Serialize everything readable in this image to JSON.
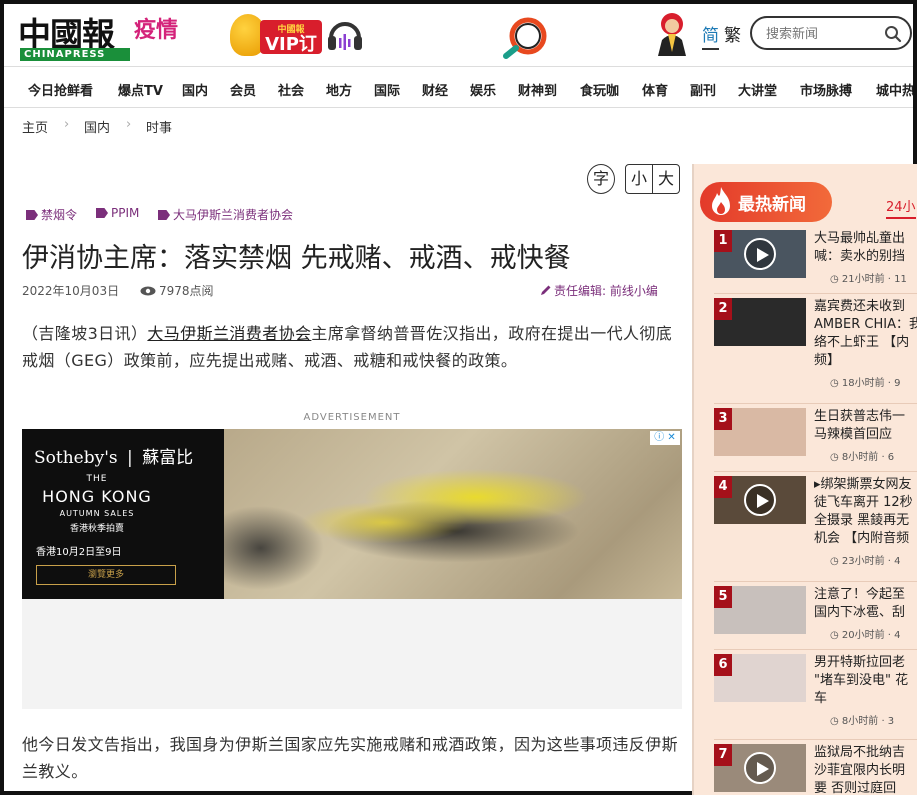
{
  "header": {
    "logo_cn": "中國報",
    "logo_epidemic": "疫情",
    "logo_en": "CHINAPRESS",
    "vip_small": "中國報",
    "vip_main": "VIP订阅",
    "lang_simplified": "简",
    "lang_traditional": "繁",
    "search_placeholder": "搜索新闻"
  },
  "nav": {
    "items": [
      "今日抢鲜看",
      "爆点TV",
      "国内",
      "会员",
      "社会",
      "地方",
      "国际",
      "财经",
      "娱乐",
      "财神到",
      "食玩咖",
      "体育",
      "副刊",
      "大讲堂",
      "市场脉搏",
      "城中热"
    ]
  },
  "breadcrumb": {
    "items": [
      "主页",
      "国内",
      "时事"
    ]
  },
  "font_controls": {
    "label": "字",
    "small": "小",
    "large": "大"
  },
  "article": {
    "tags": [
      "禁烟令",
      "PPIM",
      "大马伊斯兰消费者协会"
    ],
    "title": "伊消协主席：落实禁烟 先戒赌、戒酒、戒快餐",
    "date": "2022年10月03日",
    "views": "7978点阅",
    "editor": "责任编辑: 前线小编",
    "para1_prefix": "（吉隆坡3日讯）",
    "para1_link": "大马伊斯兰消费者协会",
    "para1_rest": "主席拿督纳普晋佐汉指出，政府在提出一代人彻底戒烟（GEG）政策前，应先提出戒赌、戒酒、戒糖和戒快餐的政策。",
    "para2": "他今日发文告指出，我国身为伊斯兰国家应先实施戒赌和戒酒政策，因为这些事项违反伊斯兰教义。"
  },
  "ad": {
    "label": "ADVERTISEMENT",
    "brand": "Sotheby's",
    "brand_cn": "蘇富比",
    "the": "THE",
    "city": "HONG KONG",
    "sales": "AUTUMN SALES",
    "sales_cn": "香港秋季拍賣",
    "dates": "香港10月2日至9日",
    "cta": "瀏覽更多"
  },
  "sidebar": {
    "title": "最热新闻",
    "tab": "24小",
    "items": [
      {
        "rank": "1",
        "lines": [
          "大马最帅乩童出",
          "喊：卖水的别挡"
        ],
        "meta": "21小时前 · 11"
      },
      {
        "rank": "2",
        "lines": [
          "嘉宾费还未收到",
          "AMBER CHIA：我",
          "络不上虾王 【内",
          "频】"
        ],
        "meta": "18小时前 · 9"
      },
      {
        "rank": "3",
        "lines": [
          "生日获普志伟一",
          "马辣模首回应"
        ],
        "meta": "8小时前 · 6"
      },
      {
        "rank": "4",
        "lines": [
          "▸绑架撕票女网友",
          "徒飞车离开 12秒",
          "全摄录 黑錂再无",
          "机会 【内附音频"
        ],
        "meta": "23小时前 · 4"
      },
      {
        "rank": "5",
        "lines": [
          "注意了！今起至",
          "国内下冰雹、刮"
        ],
        "meta": "20小时前 · 4"
      },
      {
        "rank": "6",
        "lines": [
          "男开特斯拉回老",
          "\"堵车到没电\" 花",
          "车"
        ],
        "meta": "8小时前 · 3"
      },
      {
        "rank": "7",
        "lines": [
          "监狱局不批纳吉",
          "沙菲宜限内长明",
          "要 否则过庭回"
        ],
        "meta": ""
      }
    ]
  },
  "colors": {
    "accent": "#7b2f7b",
    "hot_red": "#d81e2c",
    "sidebar_bg": "#fbe7d9",
    "link_blue": "#1d7ab5"
  }
}
